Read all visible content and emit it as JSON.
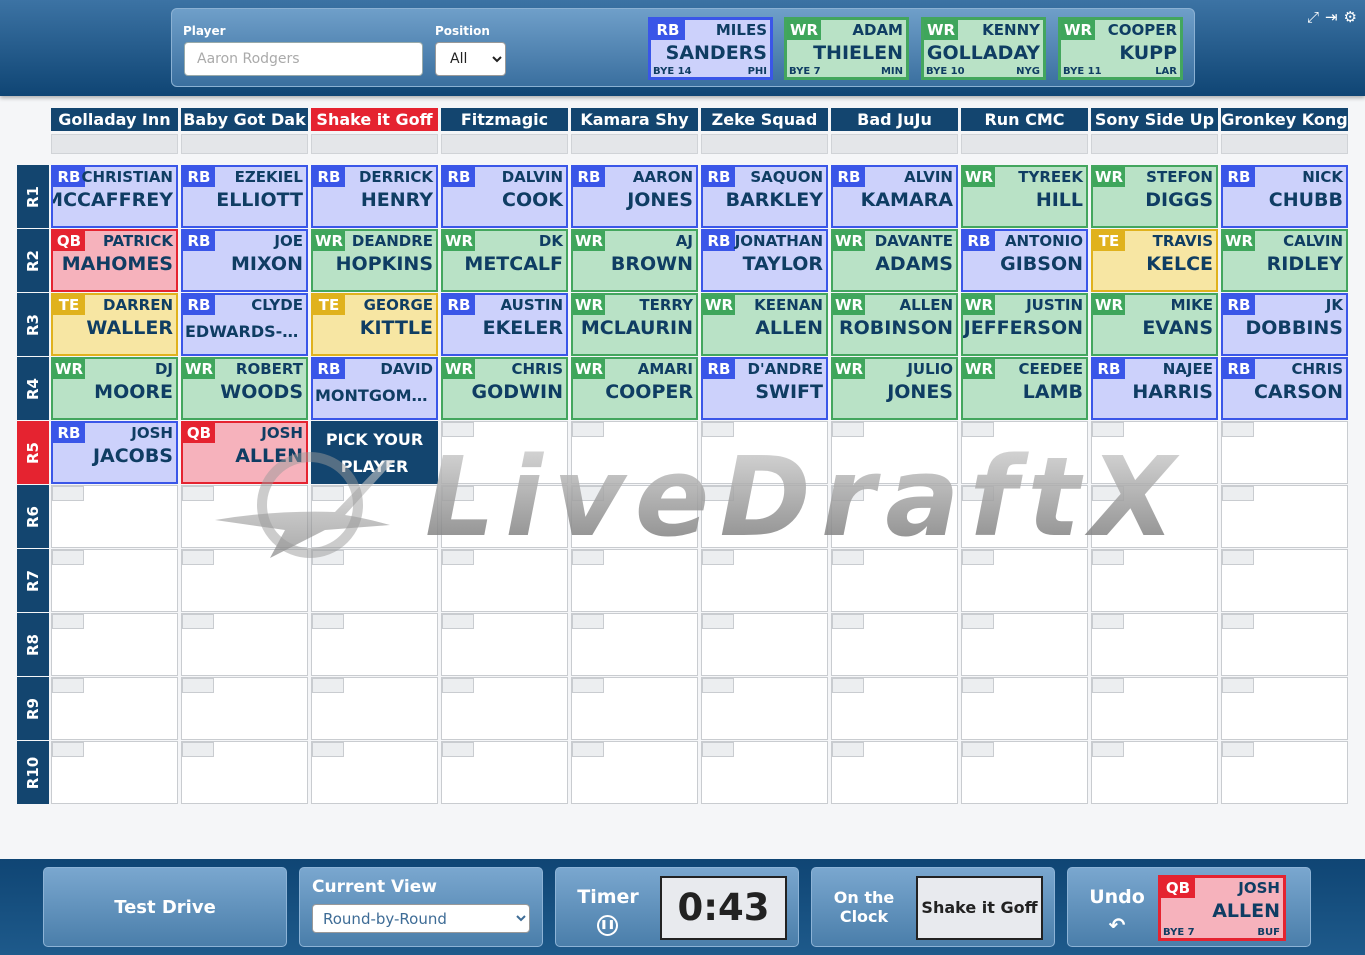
{
  "search": {
    "player_label": "Player",
    "player_placeholder": "Aaron Rodgers",
    "position_label": "Position",
    "position_value": "All"
  },
  "top_picks": [
    {
      "pos": "RB",
      "first": "MILES",
      "last": "SANDERS",
      "bye": "BYE 14",
      "team": "PHI"
    },
    {
      "pos": "WR",
      "first": "ADAM",
      "last": "THIELEN",
      "bye": "BYE 7",
      "team": "MIN"
    },
    {
      "pos": "WR",
      "first": "KENNY",
      "last": "GOLLADAY",
      "bye": "BYE 10",
      "team": "NYG"
    },
    {
      "pos": "WR",
      "first": "COOPER",
      "last": "KUPP",
      "bye": "BYE 11",
      "team": "LAR"
    }
  ],
  "icons": [
    "expand-icon",
    "exit-icon",
    "gear-icon"
  ],
  "teams": [
    "Golladay Inn",
    "Baby Got Dak",
    "Shake it Goff",
    "Fitzmagic",
    "Kamara Shy",
    "Zeke Squad",
    "Bad JuJu",
    "Run CMC",
    "Sony Side Up",
    "Gronkey Kong"
  ],
  "active_team_index": 2,
  "rounds": [
    "R1",
    "R2",
    "R3",
    "R4",
    "R5",
    "R6",
    "R7",
    "R8",
    "R9",
    "R10"
  ],
  "active_round_index": 4,
  "picks": [
    [
      {
        "pos": "RB",
        "first": "CHRISTIAN",
        "last": "MCCAFFREY"
      },
      {
        "pos": "RB",
        "first": "EZEKIEL",
        "last": "ELLIOTT"
      },
      {
        "pos": "RB",
        "first": "DERRICK",
        "last": "HENRY"
      },
      {
        "pos": "RB",
        "first": "DALVIN",
        "last": "COOK"
      },
      {
        "pos": "RB",
        "first": "AARON",
        "last": "JONES"
      },
      {
        "pos": "RB",
        "first": "SAQUON",
        "last": "BARKLEY"
      },
      {
        "pos": "RB",
        "first": "ALVIN",
        "last": "KAMARA"
      },
      {
        "pos": "WR",
        "first": "TYREEK",
        "last": "HILL"
      },
      {
        "pos": "WR",
        "first": "STEFON",
        "last": "DIGGS"
      },
      {
        "pos": "RB",
        "first": "NICK",
        "last": "CHUBB"
      }
    ],
    [
      {
        "pos": "QB",
        "first": "PATRICK",
        "last": "MAHOMES"
      },
      {
        "pos": "RB",
        "first": "JOE",
        "last": "MIXON"
      },
      {
        "pos": "WR",
        "first": "DEANDRE",
        "last": "HOPKINS"
      },
      {
        "pos": "WR",
        "first": "DK",
        "last": "METCALF"
      },
      {
        "pos": "WR",
        "first": "AJ",
        "last": "BROWN"
      },
      {
        "pos": "RB",
        "first": "JONATHAN",
        "last": "TAYLOR"
      },
      {
        "pos": "WR",
        "first": "DAVANTE",
        "last": "ADAMS"
      },
      {
        "pos": "RB",
        "first": "ANTONIO",
        "last": "GIBSON"
      },
      {
        "pos": "TE",
        "first": "TRAVIS",
        "last": "KELCE"
      },
      {
        "pos": "WR",
        "first": "CALVIN",
        "last": "RIDLEY"
      }
    ],
    [
      {
        "pos": "TE",
        "first": "DARREN",
        "last": "WALLER"
      },
      {
        "pos": "RB",
        "first": "CLYDE",
        "last": "EDWARDS-H...",
        "small": true
      },
      {
        "pos": "TE",
        "first": "GEORGE",
        "last": "KITTLE"
      },
      {
        "pos": "RB",
        "first": "AUSTIN",
        "last": "EKELER"
      },
      {
        "pos": "WR",
        "first": "TERRY",
        "last": "MCLAURIN"
      },
      {
        "pos": "WR",
        "first": "KEENAN",
        "last": "ALLEN"
      },
      {
        "pos": "WR",
        "first": "ALLEN",
        "last": "ROBINSON"
      },
      {
        "pos": "WR",
        "first": "JUSTIN",
        "last": "JEFFERSON"
      },
      {
        "pos": "WR",
        "first": "MIKE",
        "last": "EVANS"
      },
      {
        "pos": "RB",
        "first": "JK",
        "last": "DOBBINS"
      }
    ],
    [
      {
        "pos": "WR",
        "first": "DJ",
        "last": "MOORE"
      },
      {
        "pos": "WR",
        "first": "ROBERT",
        "last": "WOODS"
      },
      {
        "pos": "RB",
        "first": "DAVID",
        "last": "MONTGOME...",
        "small": true
      },
      {
        "pos": "WR",
        "first": "CHRIS",
        "last": "GODWIN"
      },
      {
        "pos": "WR",
        "first": "AMARI",
        "last": "COOPER"
      },
      {
        "pos": "RB",
        "first": "D'ANDRE",
        "last": "SWIFT"
      },
      {
        "pos": "WR",
        "first": "JULIO",
        "last": "JONES"
      },
      {
        "pos": "WR",
        "first": "CEEDEE",
        "last": "LAMB"
      },
      {
        "pos": "RB",
        "first": "NAJEE",
        "last": "HARRIS"
      },
      {
        "pos": "RB",
        "first": "CHRIS",
        "last": "CARSON"
      }
    ],
    [
      {
        "pos": "RB",
        "first": "JOSH",
        "last": "JACOBS"
      },
      {
        "pos": "QB",
        "first": "JOSH",
        "last": "ALLEN"
      }
    ]
  ],
  "pick_your_player": "PICK YOUR PLAYER",
  "bottom": {
    "test_drive": "Test Drive",
    "current_view_label": "Current View",
    "current_view_value": "Round-by-Round",
    "timer_label": "Timer",
    "timer_value": "0:43",
    "on_the_clock_label_1": "On the",
    "on_the_clock_label_2": "Clock",
    "on_the_clock_team": "Shake it Goff",
    "undo_label": "Undo",
    "undo_pick": {
      "pos": "QB",
      "first": "JOSH",
      "last": "ALLEN",
      "bye": "BYE 7",
      "team": "BUF"
    }
  },
  "colors": {
    "RB": "#3a56e8",
    "WR": "#3fa65c",
    "QB": "#e52330",
    "TE": "#e0b21d",
    "navy": "#13456f"
  }
}
